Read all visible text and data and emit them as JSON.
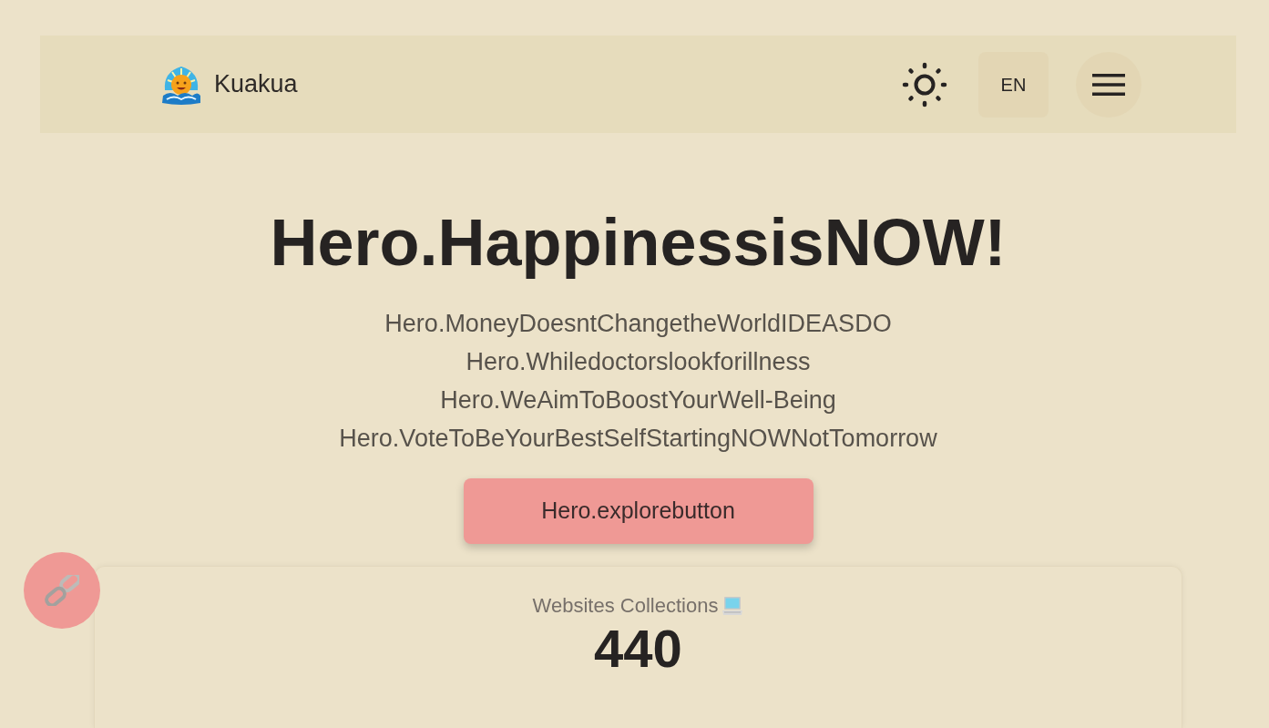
{
  "header": {
    "brand": "Kuakua",
    "language_button": "EN"
  },
  "hero": {
    "title": "Hero.HappinessisNOW!",
    "lines": [
      "Hero.MoneyDoesntChangetheWorldIDEASDO",
      "Hero.Whiledoctorslookforillness",
      "Hero.WeAimToBoostYourWell-Being",
      "Hero.VoteToBeYourBestSelfStartingNOWNotTomorrow"
    ],
    "button": "Hero.explorebutton"
  },
  "stats": [
    {
      "label": "Websites Collections",
      "value": "440"
    }
  ]
}
